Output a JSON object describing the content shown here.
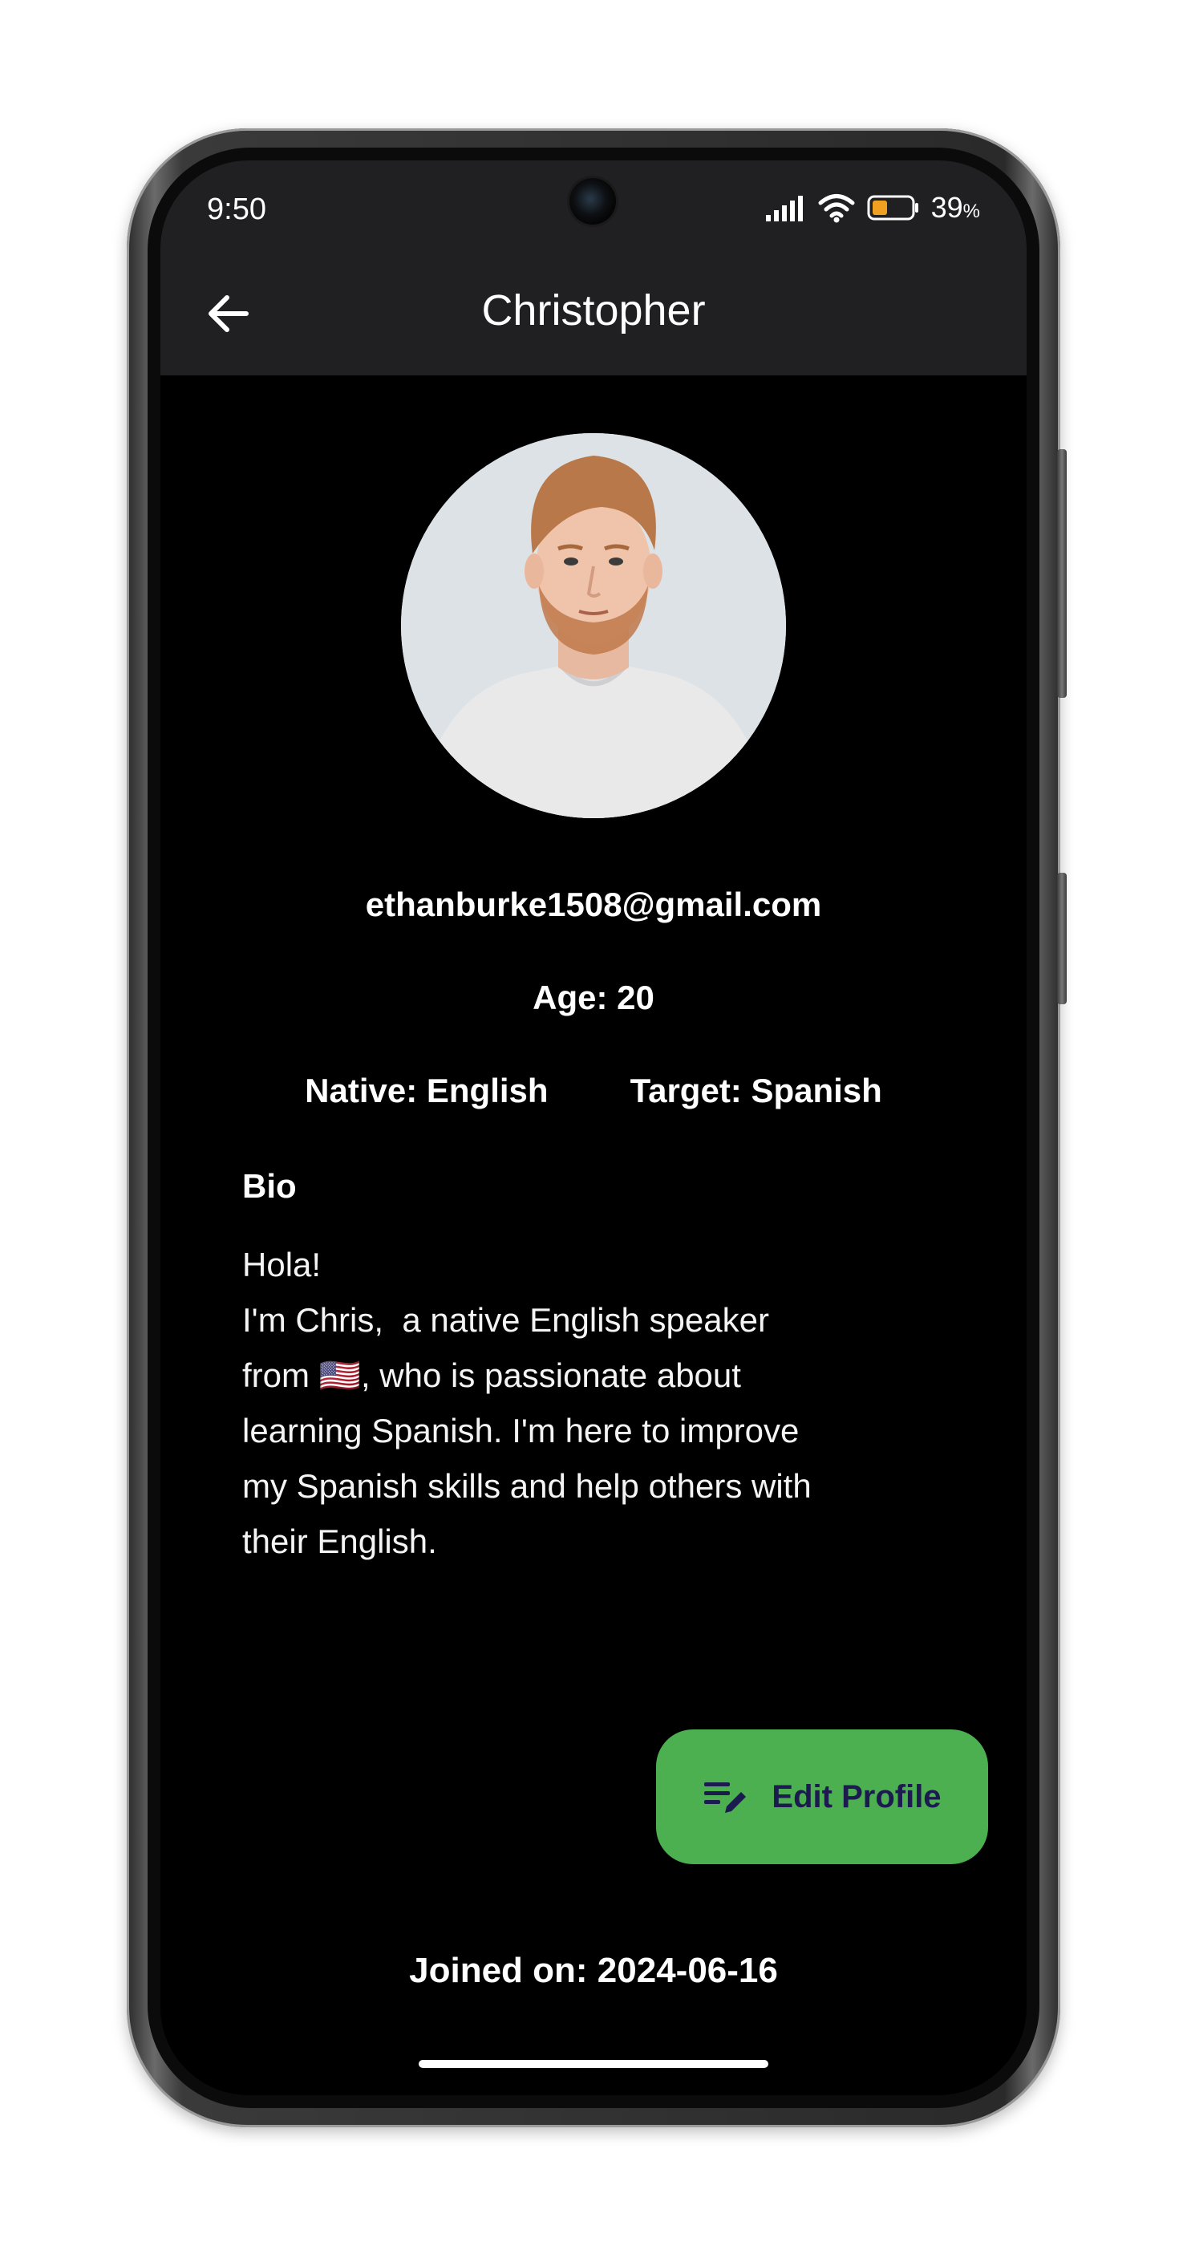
{
  "status_bar": {
    "time": "9:50",
    "battery_percent": "39",
    "battery_unit": "%",
    "battery_level": 0.39,
    "battery_color": "#f0a020"
  },
  "app_bar": {
    "title": "Christopher",
    "back_icon": "arrow-left-icon"
  },
  "profile": {
    "email": "ethanburke1508@gmail.com",
    "age": "Age: 20",
    "native": "Native: English",
    "target": "Target: Spanish",
    "bio_heading": "Bio",
    "bio_text": "Hola!\nI'm Chris,  a native English speaker\nfrom 🇺🇸, who is passionate about\nlearning Spanish. I'm here to improve\nmy Spanish skills and help others with\ntheir English.",
    "joined": "Joined on: 2024-06-16"
  },
  "fab": {
    "label": "Edit Profile",
    "icon": "edit-note-icon",
    "color": "#4caf50"
  },
  "theme": {
    "background": "#000000",
    "app_bar": "#202023",
    "text": "#ffffff"
  }
}
